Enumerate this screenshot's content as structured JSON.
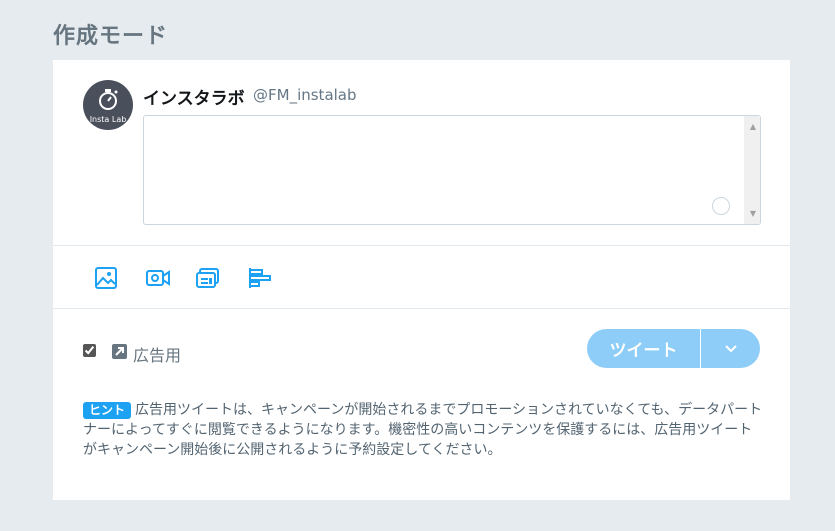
{
  "page": {
    "title": "作成モード"
  },
  "account": {
    "name": "インスタラボ",
    "handle": "@FM_instalab",
    "avatar_text": "Insta Lab"
  },
  "compose": {
    "value": "",
    "placeholder": ""
  },
  "toolbar": {
    "icons": [
      "image-icon",
      "video-icon",
      "card-icon",
      "poll-icon"
    ]
  },
  "promo": {
    "checked": true,
    "label": "広告用"
  },
  "actions": {
    "tweet_label": "ツイート"
  },
  "hint": {
    "badge": "ヒント",
    "text": "広告用ツイートは、キャンペーンが開始されるまでプロモーションされていなくても、データパートナーによってすぐに閲覧できるようになります。機密性の高いコンテンツを保護するには、広告用ツイートがキャンペーン開始後に公開されるように予約設定してください。"
  },
  "colors": {
    "accent": "#1da1f2",
    "button": "#8ecdf8",
    "background": "#e6ebef"
  }
}
